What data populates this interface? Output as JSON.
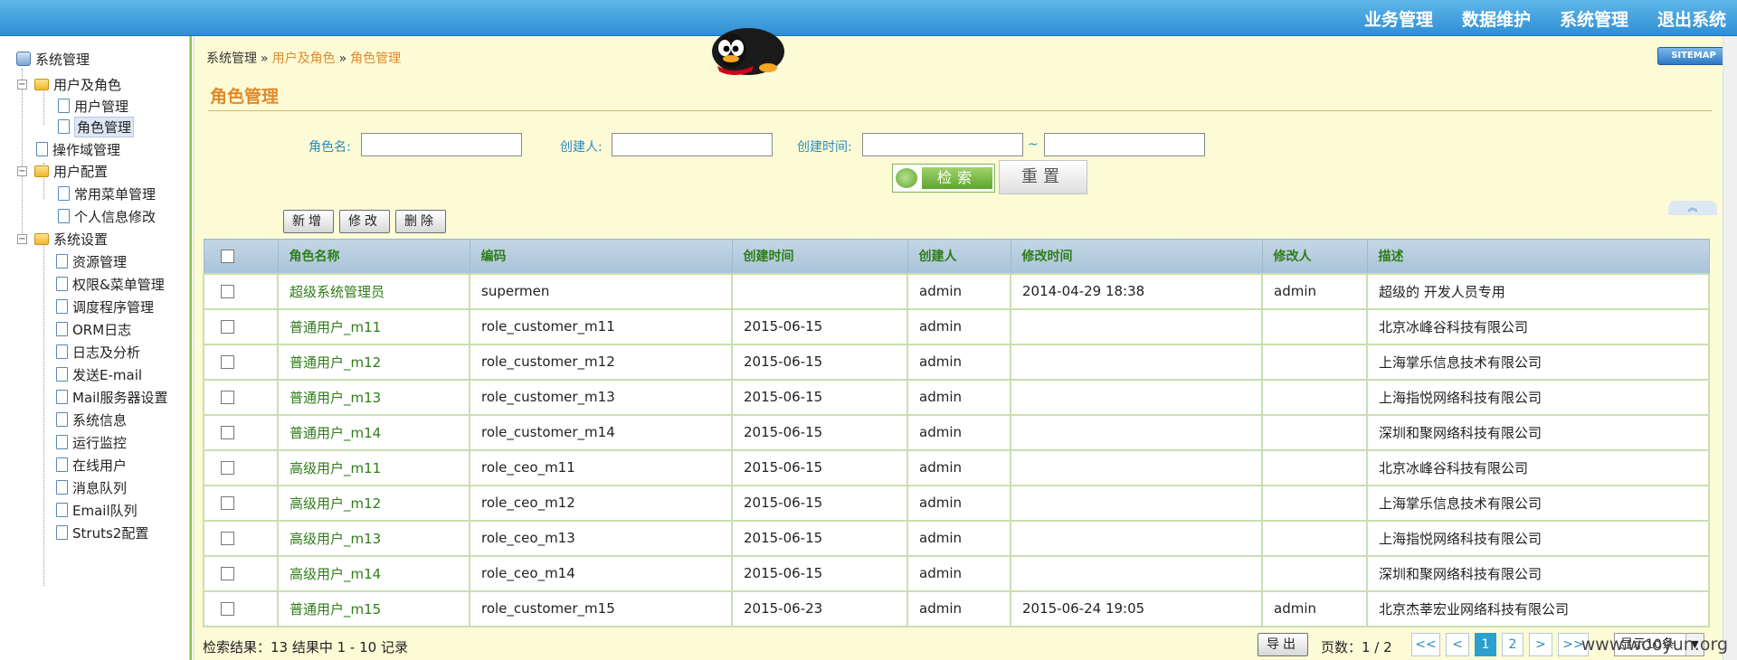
{
  "topnav": [
    "业务管理",
    "数据维护",
    "系统管理",
    "退出系统"
  ],
  "sidebar": {
    "root": "系统管理",
    "items": [
      {
        "label": "用户及角色"
      },
      {
        "label": "用户管理"
      },
      {
        "label": "角色管理"
      },
      {
        "label": "操作域管理"
      },
      {
        "label": "用户配置"
      },
      {
        "label": "常用菜单管理"
      },
      {
        "label": "个人信息修改"
      },
      {
        "label": "系统设置"
      },
      {
        "label": "资源管理"
      },
      {
        "label": "权限&菜单管理"
      },
      {
        "label": "调度程序管理"
      },
      {
        "label": "ORM日志"
      },
      {
        "label": "日志及分析"
      },
      {
        "label": "发送E-mail"
      },
      {
        "label": "Mail服务器设置"
      },
      {
        "label": "系统信息"
      },
      {
        "label": "运行监控"
      },
      {
        "label": "在线用户"
      },
      {
        "label": "消息队列"
      },
      {
        "label": "Email队列"
      },
      {
        "label": "Struts2配置"
      }
    ]
  },
  "breadcrumb": {
    "root": "系统管理",
    "sep": "»",
    "level1": "用户及角色",
    "level2": "角色管理"
  },
  "header": {
    "sitemap": "SITEMAP",
    "plus": "+"
  },
  "page": {
    "title": "角色管理"
  },
  "search": {
    "role_name_label": "角色名:",
    "creator_label": "创建人:",
    "created_time_label": "创建时间:",
    "tilde": "~",
    "search_btn": "检索",
    "reset_btn": "重置",
    "collapse": "︽"
  },
  "toolbar": {
    "add": "新增",
    "edit": "修改",
    "delete": "删除"
  },
  "table": {
    "columns": [
      "角色名称",
      "编码",
      "创建时间",
      "创建人",
      "修改时间",
      "修改人",
      "描述"
    ],
    "rows": [
      [
        "超级系统管理员",
        "supermen",
        "",
        "admin",
        "2014-04-29 18:38",
        "admin",
        "超级的 开发人员专用"
      ],
      [
        "普通用户_m11",
        "role_customer_m11",
        "2015-06-15",
        "admin",
        "",
        "",
        "北京冰峰谷科技有限公司"
      ],
      [
        "普通用户_m12",
        "role_customer_m12",
        "2015-06-15",
        "admin",
        "",
        "",
        "上海掌乐信息技术有限公司"
      ],
      [
        "普通用户_m13",
        "role_customer_m13",
        "2015-06-15",
        "admin",
        "",
        "",
        "上海指悦网络科技有限公司"
      ],
      [
        "普通用户_m14",
        "role_customer_m14",
        "2015-06-15",
        "admin",
        "",
        "",
        "深圳和聚网络科技有限公司"
      ],
      [
        "高级用户_m11",
        "role_ceo_m11",
        "2015-06-15",
        "admin",
        "",
        "",
        "北京冰峰谷科技有限公司"
      ],
      [
        "高级用户_m12",
        "role_ceo_m12",
        "2015-06-15",
        "admin",
        "",
        "",
        "上海掌乐信息技术有限公司"
      ],
      [
        "高级用户_m13",
        "role_ceo_m13",
        "2015-06-15",
        "admin",
        "",
        "",
        "上海指悦网络科技有限公司"
      ],
      [
        "高级用户_m14",
        "role_ceo_m14",
        "2015-06-15",
        "admin",
        "",
        "",
        "深圳和聚网络科技有限公司"
      ],
      [
        "普通用户_m15",
        "role_customer_m15",
        "2015-06-23",
        "admin",
        "2015-06-24 19:05",
        "admin",
        "北京杰莘宏业网络科技有限公司"
      ]
    ]
  },
  "footer": {
    "result": "检索结果：13 结果中 1 - 10 记录",
    "export": "导出",
    "pages_label": "页数：1 / 2",
    "first": "<<",
    "prev": "<",
    "page1": "1",
    "page2": "2",
    "next": ">",
    "last": ">>",
    "page_size": "显示10条"
  },
  "watermark": "www.wooyun.org",
  "colors": {
    "accent_orange": "#e08a2a",
    "link_green": "#2e7d17",
    "label_blue": "#2d8bc0",
    "top_blue": "#2e8fd6"
  }
}
